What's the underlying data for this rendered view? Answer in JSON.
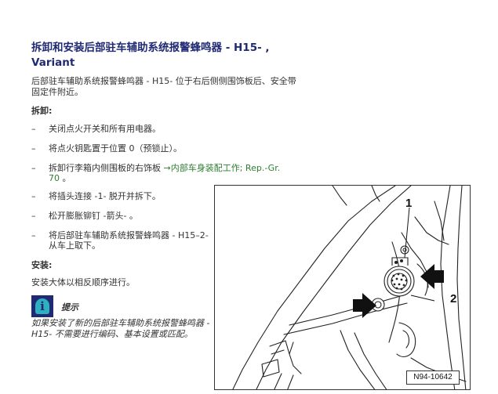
{
  "title": "拆卸和安装后部驻车辅助系统报警蜂鸣器 - H15- , Variant",
  "intro": "后部驻车辅助系统报警蜂鸣器 - H15- 位于右后侧侧围饰板后、安全带固定件附近。",
  "removal_heading": "拆卸:",
  "steps": [
    {
      "dash": "–",
      "text": "关闭点火开关和所有用电器。"
    },
    {
      "dash": "–",
      "text": "将点火钥匙置于位置 0（预锁止）。"
    },
    {
      "dash": "–",
      "text": "拆卸行李箱内侧围板的右饰板 ",
      "link": "→内部车身装配工作; Rep.-Gr. 70",
      "after": " 。"
    },
    {
      "dash": "–",
      "text": "将插头连接 -1- 脱开并拆下。"
    },
    {
      "dash": "–",
      "text": "松开膨胀铆钉 -箭头- 。"
    },
    {
      "dash": "–",
      "text": "将后部驻车辅助系统报警蜂鸣器 - H15–2- 从车上取下。"
    }
  ],
  "install_heading": "安装:",
  "install_text": "安装大体以相反顺序进行。",
  "note": {
    "icon": "info-icon",
    "icon_glyph": "i",
    "label": "提示",
    "text": "如果安装了新的后部驻车辅助系统报警蜂鸣器 - H15- 不需要进行编码、基本设置或匹配。"
  },
  "figure": {
    "callouts": [
      "1",
      "2"
    ],
    "id": "N94-10642"
  }
}
